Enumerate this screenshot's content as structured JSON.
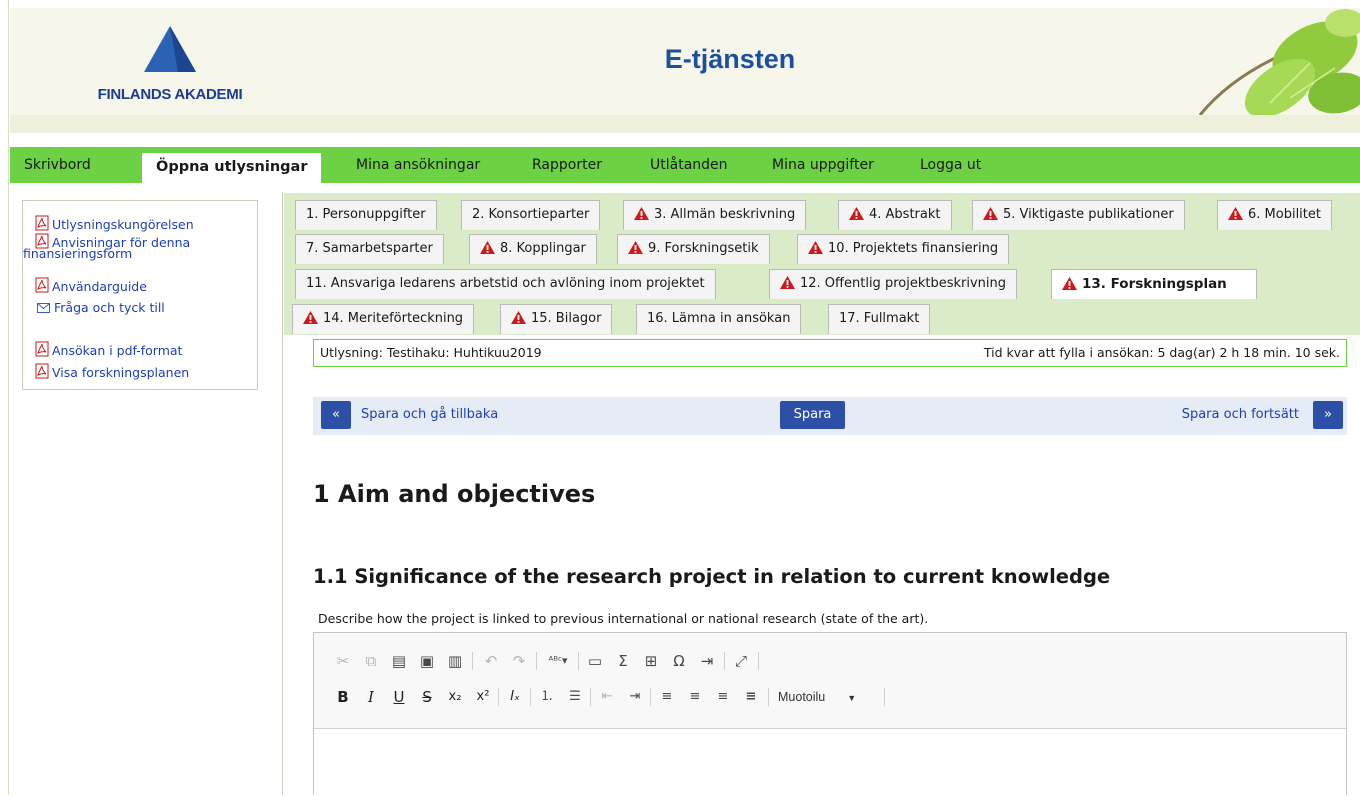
{
  "header": {
    "logo_text": "FINLANDS AKADEMI",
    "site_title": "E-tjänsten"
  },
  "nav": {
    "items": [
      {
        "label": "Skrivbord",
        "active": false
      },
      {
        "label": "Öppna utlysningar",
        "active": true
      },
      {
        "label": "Mina ansökningar",
        "active": false
      },
      {
        "label": "Rapporter",
        "active": false
      },
      {
        "label": "Utlåtanden",
        "active": false
      },
      {
        "label": "Mina uppgifter",
        "active": false
      },
      {
        "label": "Logga ut",
        "active": false
      }
    ]
  },
  "sidebar": {
    "links": [
      {
        "label": "Utlysningskungörelsen",
        "icon": "pdf-icon"
      },
      {
        "label_line1": "Anvisningar för denna",
        "label_line2": "finansieringsform",
        "icon": "pdf-icon"
      },
      {
        "label": "Användarguide",
        "icon": "pdf-icon"
      },
      {
        "label": "Fråga och tyck till",
        "icon": "mail-icon"
      },
      {
        "label": "Ansökan i pdf-format",
        "icon": "pdf-icon"
      },
      {
        "label": "Visa forskningsplanen",
        "icon": "pdf-icon"
      }
    ]
  },
  "tabs": [
    {
      "label": "1. Personuppgifter",
      "warning": false
    },
    {
      "label": "2. Konsortieparter",
      "warning": false
    },
    {
      "label": "3. Allmän beskrivning",
      "warning": true
    },
    {
      "label": "4. Abstrakt",
      "warning": true
    },
    {
      "label": "5. Viktigaste publikationer",
      "warning": true
    },
    {
      "label": "6. Mobilitet",
      "warning": true
    },
    {
      "label": "7. Samarbetsparter",
      "warning": false
    },
    {
      "label": "8. Kopplingar",
      "warning": true
    },
    {
      "label": "9. Forskningsetik",
      "warning": true
    },
    {
      "label": "10. Projektets finansiering",
      "warning": true
    },
    {
      "label": "11. Ansvariga ledarens arbetstid och avlöning inom projektet",
      "warning": false
    },
    {
      "label": "12. Offentlig projektbeskrivning",
      "warning": true
    },
    {
      "label": "13. Forskningsplan",
      "warning": true,
      "active": true
    },
    {
      "label": "14. Meriteförteckning",
      "warning": true
    },
    {
      "label": "15. Bilagor",
      "warning": true
    },
    {
      "label": "16. Lämna in ansökan",
      "warning": false
    },
    {
      "label": "17. Fullmakt",
      "warning": false
    }
  ],
  "info": {
    "call": "Utlysning: Testihaku: Huhtikuu2019",
    "time_left": "Tid kvar att fylla i ansökan: 5 dag(ar) 2 h 18 min. 10 sek."
  },
  "actions": {
    "back_symbol": "«",
    "back_label": "Spara och gå tillbaka",
    "save_label": "Spara",
    "forward_label": "Spara och fortsätt",
    "forward_symbol": "»"
  },
  "content": {
    "heading1": "1 Aim and objectives",
    "heading2": "1.1 Significance of the research project in relation to current knowledge",
    "description": "Describe how the project is linked to previous international or national research (state of the art)."
  },
  "editor": {
    "format_label": "Muotoilu",
    "text": ""
  },
  "colors": {
    "nav_green": "#6cd143",
    "tab_area_bg": "#d9ecc7",
    "link_blue": "#1d3fb5",
    "button_blue": "#2e4fa6",
    "warning_red": "#cc1a1a",
    "title_blue": "#1d4f9e"
  }
}
